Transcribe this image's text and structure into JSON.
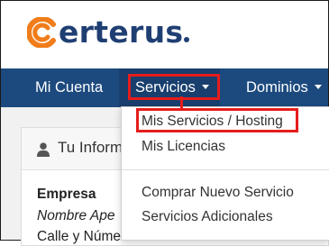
{
  "header": {
    "logo_text": "erterus"
  },
  "navbar": {
    "items": [
      {
        "label": "Mi Cuenta"
      },
      {
        "label": "Servicios"
      },
      {
        "label": "Dominios"
      }
    ]
  },
  "dropdown": {
    "items": [
      {
        "label": "Mis Servicios / Hosting"
      },
      {
        "label": "Mis Licencias"
      },
      {
        "label": "Comprar Nuevo Servicio"
      },
      {
        "label": "Servicios Adicionales"
      }
    ]
  },
  "panel": {
    "title": "Tu Inform",
    "company_label": "Empresa",
    "name_line": "Nombre Ape",
    "address_line": "Calle y Número"
  },
  "colors": {
    "brand": "#1f3f73",
    "accent": "#f07d1a",
    "navbar": "#1c4a7e",
    "highlight": "#e51c1c"
  }
}
